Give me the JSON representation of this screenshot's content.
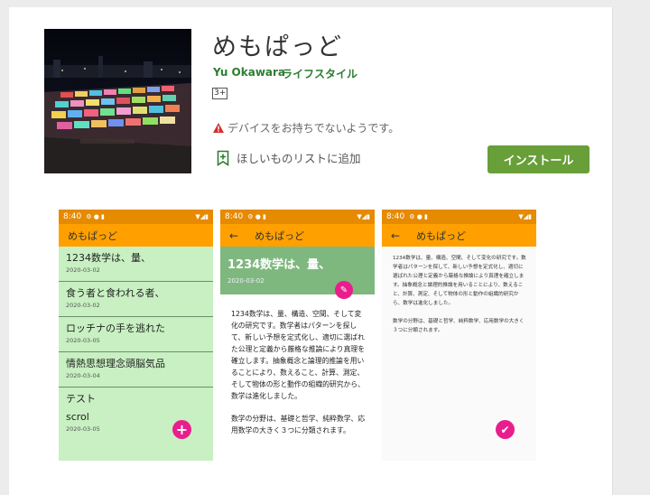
{
  "app": {
    "title": "めもぱっど",
    "developer": "Yu Okawara",
    "category": "ライフスタイル",
    "rating": "3+",
    "warning": "デバイスをお持ちでないようです。",
    "wishlist_label": "ほしいものリストに追加",
    "install_label": "インストール"
  },
  "colors": {
    "accent": "#689f38",
    "app_bar": "#ffa000",
    "status_bar": "#e68a00",
    "list_bg": "#c8f0c2",
    "detail_header": "#7fb87f",
    "fab": "#e91e8c"
  },
  "screens": {
    "status_time": "8:40",
    "list": {
      "title": "めもぱっど",
      "items": [
        {
          "title": "1234数学は、量、",
          "date": "2020-03-02"
        },
        {
          "title": "食う者と食われる者、",
          "date": "2020-03-02"
        },
        {
          "title": "ロッチナの手を逃れた",
          "date": "2020-03-05"
        },
        {
          "title": "情熱思想理念頭脳気品",
          "date": "2020-03-04"
        },
        {
          "title": "テスト",
          "date": ""
        },
        {
          "title": "scrol",
          "date": "2020-03-05"
        }
      ]
    },
    "detail": {
      "title": "めもぱっど",
      "heading": "1234数学は、量、",
      "date": "2020-03-02",
      "body1": "1234数学は、量、構造、空間、そして変化の研究です。数学者はパターンを探して、新しい予想を定式化し、適切に選ばれた公理と定義から厳格な推論により真理を確立します。抽象概念と論理的推論を用いることにより、数えること、計算、測定、そして物体の形と動作の組織的研究から、数学は進化しました。",
      "body2": "数学の分野は、基礎と哲学、純粋数学、応用数学の大きく３つに分類されます。"
    },
    "edit": {
      "title": "めもぱっど",
      "body1": "1234数学は、量、構造、空間、そして変化の研究です。数学者はパターンを探して、新しい予想を定式化し、適切に選ばれた公理と定義から厳格な推論により真理を確立します。抽象概念と論理的推論を用いることにより、数えること、計算、測定、そして物体の形と動作の組織的研究から、数学は進化しました。",
      "body2": "数学の分野は、基礎と哲学、純粋数学、応用数学の大きく３つに分類されます。"
    }
  }
}
